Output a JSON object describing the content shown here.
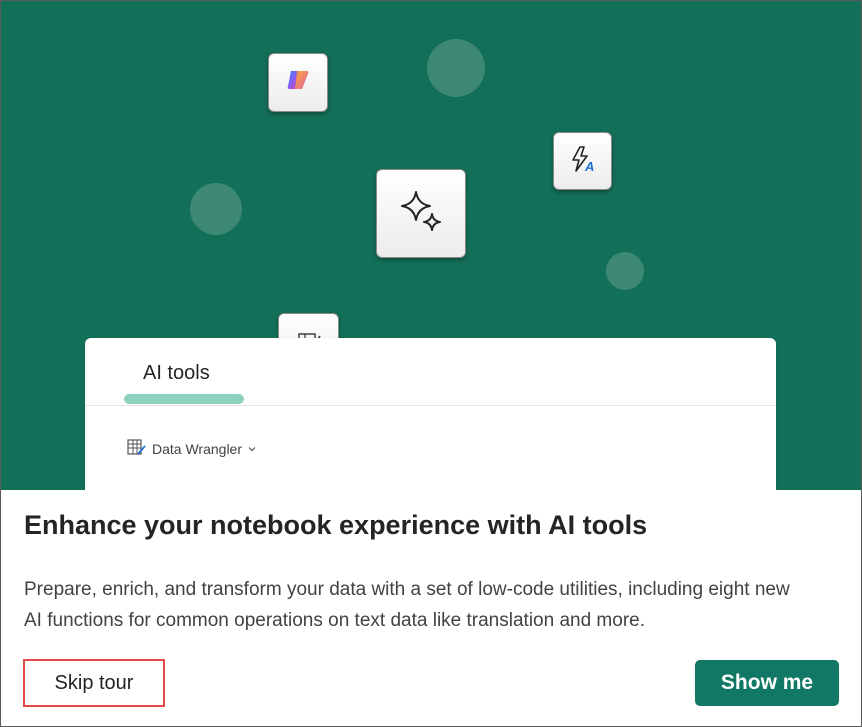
{
  "hero": {
    "card": {
      "tab_label": "AI tools",
      "dropdown_label": "Data Wrangler"
    },
    "colors": {
      "background": "#137058",
      "tab_underline": "#8fd1bf"
    },
    "icons": [
      "copilot-icon",
      "sparkle-icon",
      "lightning-a-icon",
      "data-wrangler-icon"
    ]
  },
  "content": {
    "title": "Enhance your notebook experience with AI tools",
    "description": "Prepare, enrich, and transform your data with a set of low-code utilities, including eight new AI functions for common operations on text data like translation and more."
  },
  "actions": {
    "skip_label": "Skip tour",
    "show_label": "Show me",
    "primary_color": "#117865",
    "highlight_color": "#e14a4a"
  }
}
